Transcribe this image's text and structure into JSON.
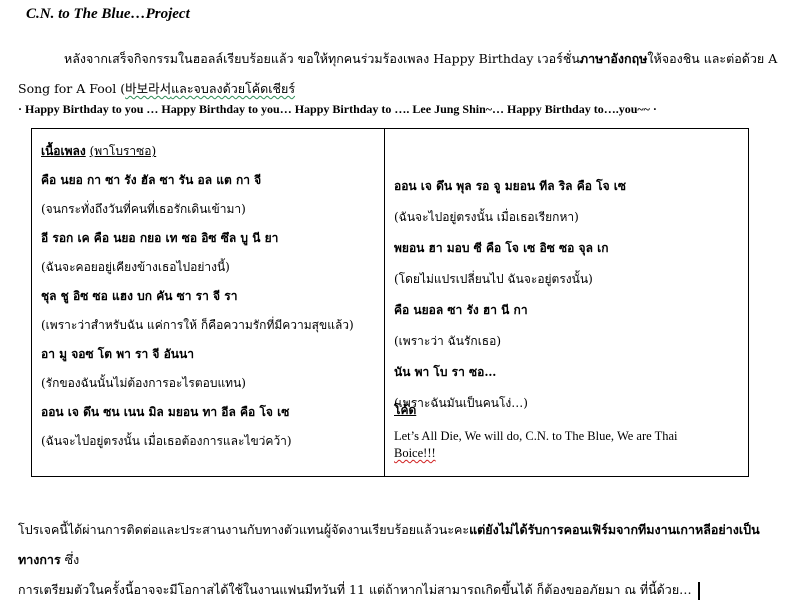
{
  "document": {
    "title": "C.N. to The Blue…Project",
    "intro": {
      "part1": "หลังจากเสร็จกิจกรรมในฮอลล์เรียบร้อยแล้ว ขอให้ทุกคนร่วมร้องเพลง Happy Birthday เวอร์ชั่น",
      "bold_part": "ภาษาอังกฤษ",
      "part2": "ให้จองชิน และต่อด้วย A",
      "line2_start": "Song for A Fool (",
      "korean": "바보라서",
      "line2_end": "และจบลงด้วยโค้ดเชียร์"
    },
    "birthday_line": "· Happy Birthday to you … Happy Birthday to you… Happy Birthday to …. Lee Jung Shin~… Happy Birthday to….you~~ ·",
    "lyrics": {
      "heading": "เนื้อเพลง",
      "heading_note": "(พาโบราซอ)",
      "left_lines": [
        {
          "text": "คือ นยอ กา ซา รัง ฮัล ซา รัน อล แต กา จี",
          "bold": true
        },
        {
          "text": "(จนกระทั่งถึงวันที่คนที่เธอรักเดินเข้ามา)",
          "bold": false
        },
        {
          "text": "อี รอก เค คือ นยอ กยอ เท ซอ อิซ ซึล บู นี ยา",
          "bold": true
        },
        {
          "text": "(ฉันจะคอยอยู่เคียงข้างเธอไปอย่างนี้)",
          "bold": false
        },
        {
          "text": "ชุล ชู อิซ ซอ แฮง บก คัน ซา รา จี รา",
          "bold": true
        },
        {
          "text": "(เพราะว่าสำหรับฉัน แค่การให้ ก็คือความรักที่มีความสุขแล้ว)",
          "bold": false
        },
        {
          "text": "อา มู จอซ โต พา รา จี อันนา",
          "bold": true
        },
        {
          "text": "(รักของฉันนั้นไม่ต้องการอะไรตอบแทน)",
          "bold": false
        },
        {
          "text": "ออน เจ ดึน ซน เนน มิล มยอน ทา อีล คือ โจ เซ",
          "bold": true
        },
        {
          "text": "(ฉันจะไปอยู่ตรงนั้น เมื่อเธอต้องการและไขว่คว้า)",
          "bold": false
        }
      ],
      "right_lines": [
        {
          "text": "ออน เจ ดึน พุล รอ จู มยอน ทีล ริล คือ โจ เซ",
          "bold": true
        },
        {
          "text": "(ฉันจะไปอยู่ตรงนั้น เมื่อเธอเรียกหา)",
          "bold": false
        },
        {
          "text": "พยอน ฮา มอบ ซี คือ โจ เซ อิซ ซอ จุล เก",
          "bold": true
        },
        {
          "text": "(โดยไม่แปรเปลี่ยนไป ฉันจะอยู่ตรงนั้น)",
          "bold": false
        },
        {
          "text": "คือ นยอล ซา รัง ฮา นี กา",
          "bold": true
        },
        {
          "text": "(เพราะว่า ฉันรักเธอ)",
          "bold": false
        },
        {
          "text": "นัน พา โบ รา ซอ…",
          "bold": true
        },
        {
          "text": "(เพราะฉันมันเป็นคนโง่…)",
          "bold": false
        }
      ],
      "cheer_title": "โค้ด",
      "cheer_text": "Let’s All Die, We will do, C.N. to The Blue, We are Thai",
      "cheer_text_end": "Boice!!!"
    },
    "outro": {
      "part1": "โปรเจคนี้ได้ผ่านการติดต่อและประสานงานกับทางตัวแทนผู้จัดงานเรียบร้อยแล้วนะคะ",
      "bold_part": "แต่ยังไม่ได้รับการคอนเฟิร์มจากทีมงานเกาหลีอย่างเป็นทางการ",
      "part2": " ซึ่ง",
      "line2": "การเตรียมตัวในครั้งนี้อาจจะมีโอกาสได้ใช้ในงานแฟนมีทวันที่ 11 แต่ถ้าหากไม่สามารถเกิดขึ้นได้ ก็ต้องขออภัยมา ณ ที่นี้ด้วย…"
    }
  }
}
